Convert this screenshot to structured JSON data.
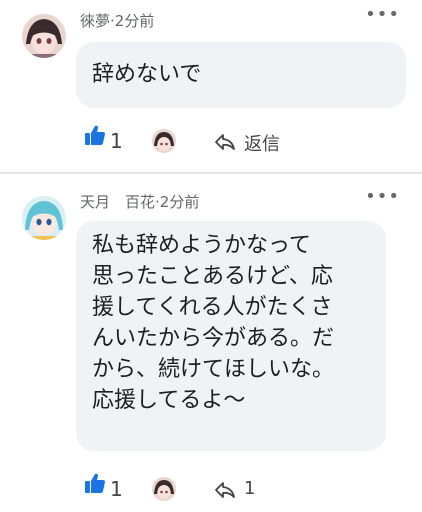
{
  "comments": [
    {
      "author": "徠夢",
      "time": "2分前",
      "lines": [
        "辞めないで"
      ],
      "likes": "1",
      "reply_label": "返信"
    },
    {
      "author": "天月　百花",
      "time": "2分前",
      "lines": [
        "私も辞めようかなって",
        "思ったことあるけど、応",
        "援してくれる人がたくさ",
        "んいたから今がある。だ",
        "から、続けてほしいな。",
        "応援してるよ〜"
      ],
      "likes": "1",
      "reply_label": "1"
    }
  ],
  "more_glyph": "•••",
  "separator": "·",
  "colors": {
    "like": "#1b74e4",
    "bubble": "#f0f2f5",
    "meta": "#65676b"
  }
}
